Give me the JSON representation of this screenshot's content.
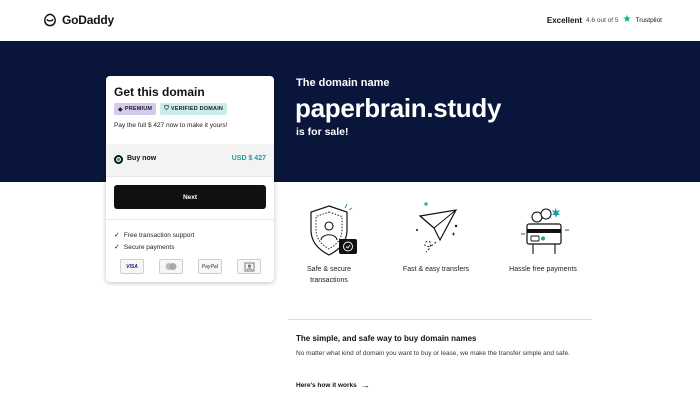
{
  "header": {
    "logo_text": "GoDaddy",
    "trustpilot": {
      "label": "Excellent",
      "rating": "4.6 out of 5",
      "brand": "Trustpilot",
      "star_color": "#00b67a"
    }
  },
  "hero": {
    "kicker": "The domain name",
    "domain": "paperbrain.study",
    "suffix": "is for sale!",
    "background": "#09153a"
  },
  "card": {
    "title": "Get this domain",
    "badges": [
      {
        "label": "PREMIUM",
        "icon": "gem-icon",
        "color": "#d6c9ef"
      },
      {
        "label": "VERIFIED DOMAIN",
        "icon": "shield-check-icon",
        "color": "#c9ecec"
      }
    ],
    "description": "Pay the full $ 427 now to make it yours!",
    "option": {
      "label": "Buy now",
      "price": "USD $ 427",
      "selected": true,
      "price_color": "#1e9ca3"
    },
    "next_label": "Next",
    "features": [
      "Free transaction support",
      "Secure payments"
    ],
    "payment_methods": [
      "VISA",
      "mastercard-icon",
      "PayPal",
      "bank-transfer-icon"
    ],
    "payment_visa": "VISA",
    "payment_paypal": "PayPal"
  },
  "icon_features": [
    {
      "icon": "shield-user-icon",
      "label_lines": [
        "Safe & secure",
        "transactions"
      ]
    },
    {
      "icon": "paper-plane-icon",
      "label_lines": [
        "Fast & easy transfers"
      ]
    },
    {
      "icon": "card-hand-icon",
      "label_lines": [
        "Hassle free payments"
      ]
    }
  ],
  "info": {
    "title": "The simple, and safe way to buy domain names",
    "body": "No matter what kind of domain you want to buy or lease, we make the transfer simple and safe.",
    "link": "Here's how it works"
  }
}
